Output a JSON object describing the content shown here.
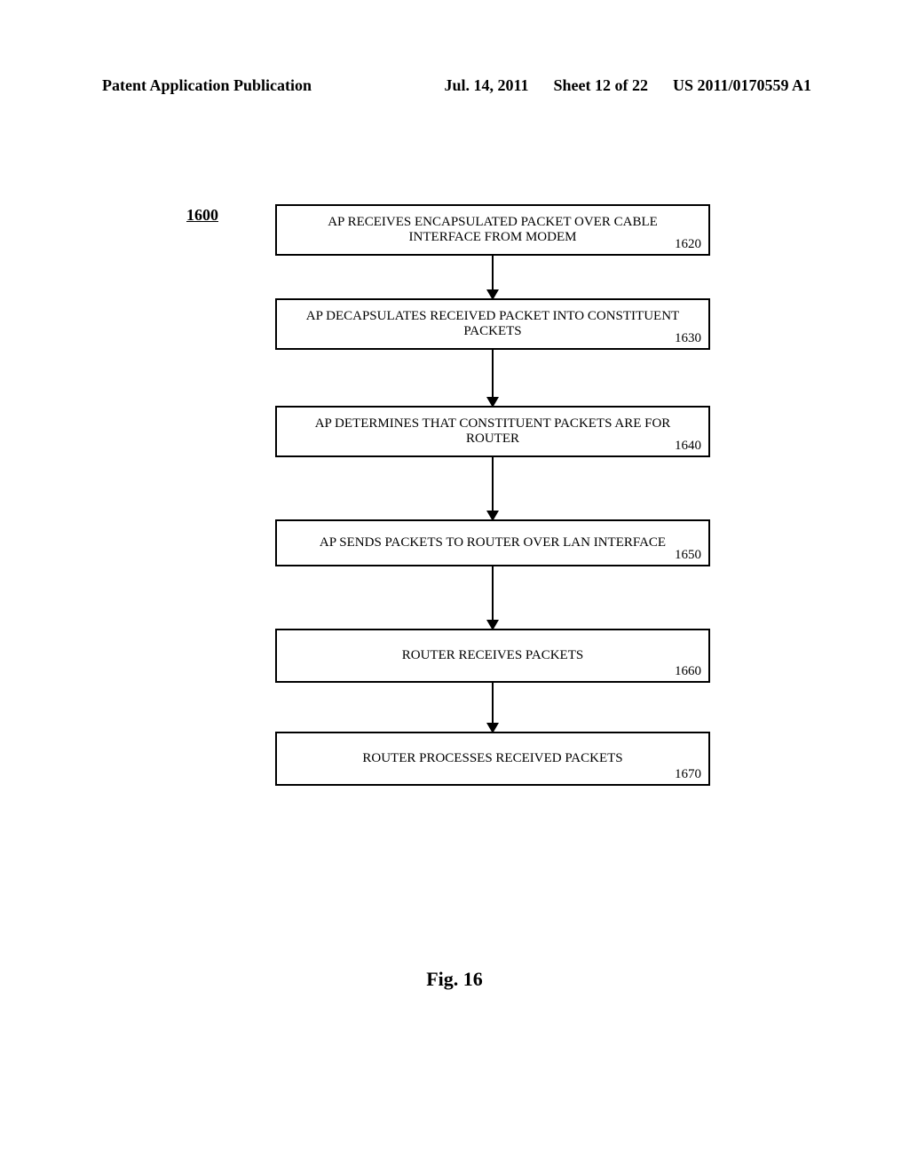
{
  "header": {
    "left": "Patent Application Publication",
    "date": "Jul. 14, 2011",
    "sheet": "Sheet 12 of 22",
    "pubno": "US 2011/0170559 A1"
  },
  "figure_ref": "1600",
  "steps": [
    {
      "text": "AP RECEIVES ENCAPSULATED PACKET OVER CABLE INTERFACE FROM MODEM",
      "ref": "1620",
      "arrow_h": 48
    },
    {
      "text": "AP DECAPSULATES RECEIVED PACKET INTO CONSTITUENT PACKETS",
      "ref": "1630",
      "arrow_h": 63
    },
    {
      "text": "AP DETERMINES THAT CONSTITUENT PACKETS ARE FOR ROUTER",
      "ref": "1640",
      "arrow_h": 70
    },
    {
      "text": "AP SENDS PACKETS TO ROUTER OVER LAN INTERFACE",
      "ref": "1650",
      "arrow_h": 70
    },
    {
      "text": "ROUTER RECEIVES PACKETS",
      "ref": "1660",
      "arrow_h": 55
    },
    {
      "text": "ROUTER PROCESSES RECEIVED PACKETS",
      "ref": "1670",
      "arrow_h": 0
    }
  ],
  "caption": "Fig. 16"
}
